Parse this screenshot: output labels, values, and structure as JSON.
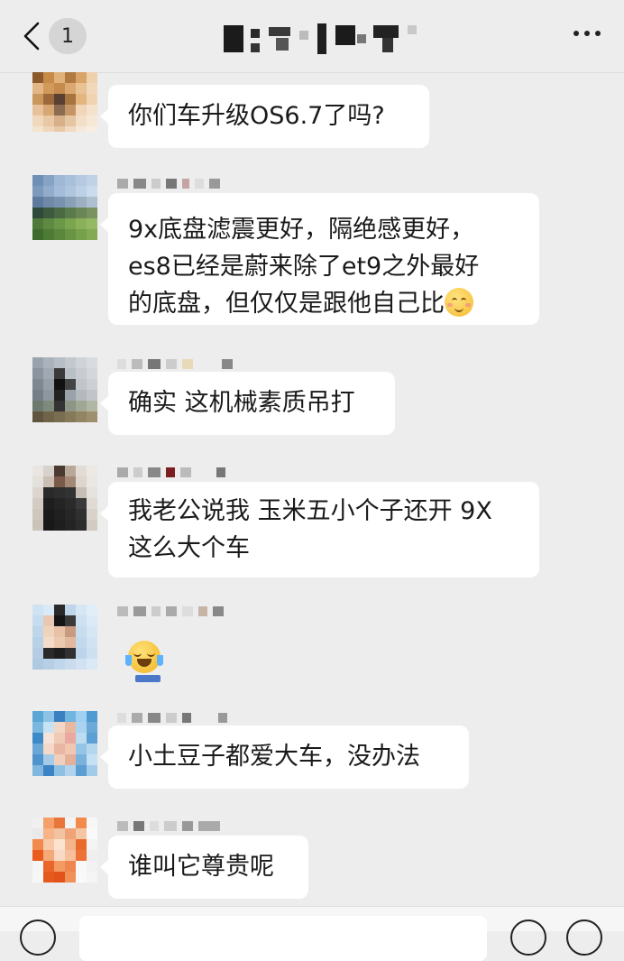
{
  "header": {
    "unread_count": "1",
    "back_icon": "chevron-left-icon",
    "more_icon": "more-dots-icon"
  },
  "messages": [
    {
      "text": "你们车升级OS6.7了吗?"
    },
    {
      "lines": [
        "9x底盘滤震更好，隔绝感更好，",
        "es8已经是蔚来除了et9之外最好",
        "的底盘，但仅仅是跟他自己比"
      ],
      "emoji": "blushing-face-icon"
    },
    {
      "text": "确实 这机械素质吊打"
    },
    {
      "lines": [
        "我老公说我 玉米五小个子还开 9X",
        "这么大个车"
      ]
    },
    {
      "sticker": "laughing-tears-sticker"
    },
    {
      "text": "小土豆子都爱大车，没办法"
    },
    {
      "text": "谁叫它尊贵呢"
    }
  ],
  "colors": {
    "background": "#ededed",
    "bubble": "#ffffff",
    "text": "#1a1a1a"
  }
}
